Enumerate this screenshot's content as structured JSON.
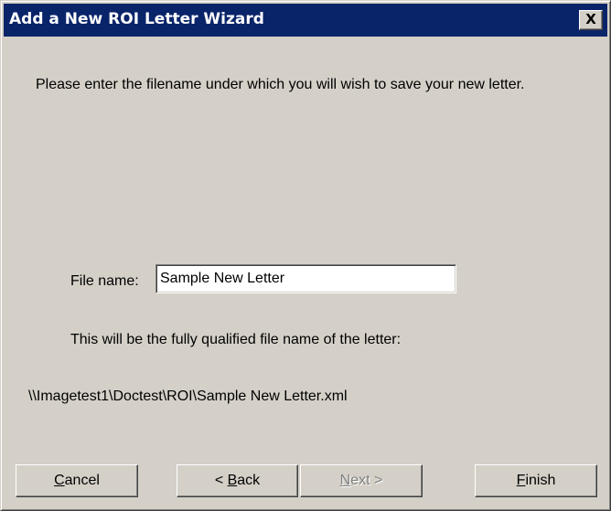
{
  "window": {
    "title": "Add a New ROI Letter Wizard",
    "close_label": "X"
  },
  "prompt": {
    "text": "Please enter the filename under which you will wish to save your new letter."
  },
  "file_name": {
    "label": "File name:",
    "value": "Sample New Letter"
  },
  "qualified": {
    "label": "This will be the fully qualified file name of the letter:",
    "path": "\\\\Imagetest1\\Doctest\\ROI\\Sample New Letter.xml"
  },
  "buttons": {
    "cancel": {
      "underlined": "C",
      "rest": "ancel",
      "enabled": true
    },
    "back": {
      "prefix": "< ",
      "underlined": "B",
      "rest": "ack",
      "enabled": true
    },
    "next": {
      "underlined": "N",
      "rest": "ext >",
      "enabled": false
    },
    "finish": {
      "underlined": "F",
      "rest": "inish",
      "enabled": true
    }
  },
  "colors": {
    "titlebar": "#0a246a",
    "face": "#d4d0c8",
    "disabled_text": "#808080"
  }
}
